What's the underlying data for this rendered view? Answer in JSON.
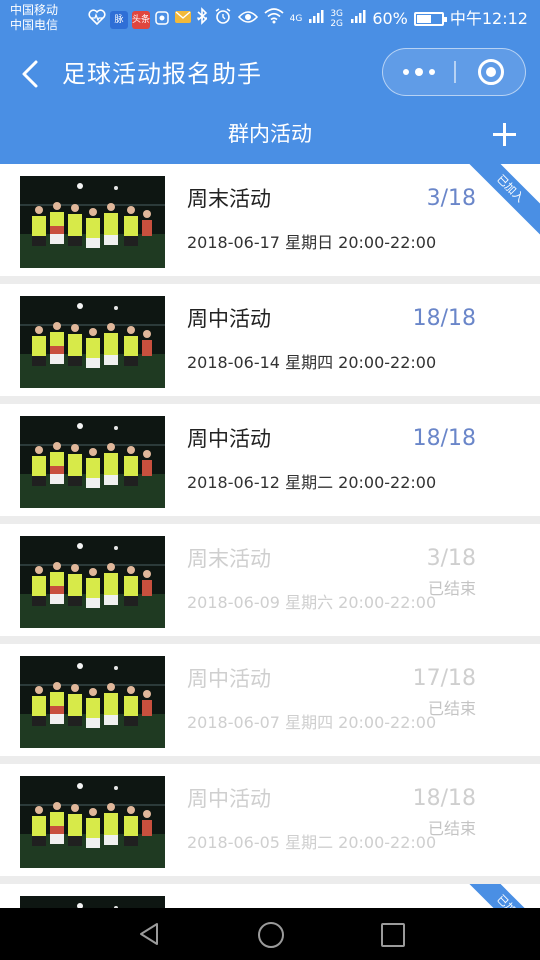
{
  "status_bar": {
    "carrier_1": "中国移动",
    "carrier_2": "中国电信",
    "notif_label_1": "脉",
    "notif_label_2": "头条",
    "more_dots": "···",
    "network_1": "4G",
    "network_2": "3G 2G",
    "battery": "60%",
    "battery_level": 0.6,
    "time": "中午12:12",
    "icons": [
      "heart-pulse-icon",
      "maimai-icon",
      "toutiao-icon",
      "app-icon",
      "mail-icon",
      "bluetooth-icon",
      "alarm-icon",
      "eye-icon",
      "wifi-icon",
      "signal-icon",
      "battery-icon"
    ]
  },
  "header": {
    "app_title": "足球活动报名助手",
    "sub_title": "群内活动",
    "background": "#4a8fe4"
  },
  "activities": [
    {
      "name": "周末活动",
      "count": "3/18",
      "date": "2018-06-17 星期日 20:00-22:00",
      "badge": "已加入",
      "ended": ""
    },
    {
      "name": "周中活动",
      "count": "18/18",
      "date": "2018-06-14 星期四 20:00-22:00",
      "badge": "",
      "ended": ""
    },
    {
      "name": "周中活动",
      "count": "18/18",
      "date": "2018-06-12 星期二 20:00-22:00",
      "badge": "",
      "ended": ""
    },
    {
      "name": "周末活动",
      "count": "3/18",
      "date": "2018-06-09 星期六 20:00-22:00",
      "badge": "",
      "ended": "已结束"
    },
    {
      "name": "周中活动",
      "count": "17/18",
      "date": "2018-06-07 星期四 20:00-22:00",
      "badge": "",
      "ended": "已结束"
    },
    {
      "name": "周中活动",
      "count": "18/18",
      "date": "2018-06-05 星期二 20:00-22:00",
      "badge": "",
      "ended": "已结束"
    },
    {
      "name": "",
      "count": "",
      "date": "",
      "badge": "已加入",
      "ended": ""
    }
  ],
  "colors": {
    "accent": "#4a8fe4",
    "count": "#6a86c9",
    "ended": "#cfcfcf",
    "separator": "#ececec"
  }
}
